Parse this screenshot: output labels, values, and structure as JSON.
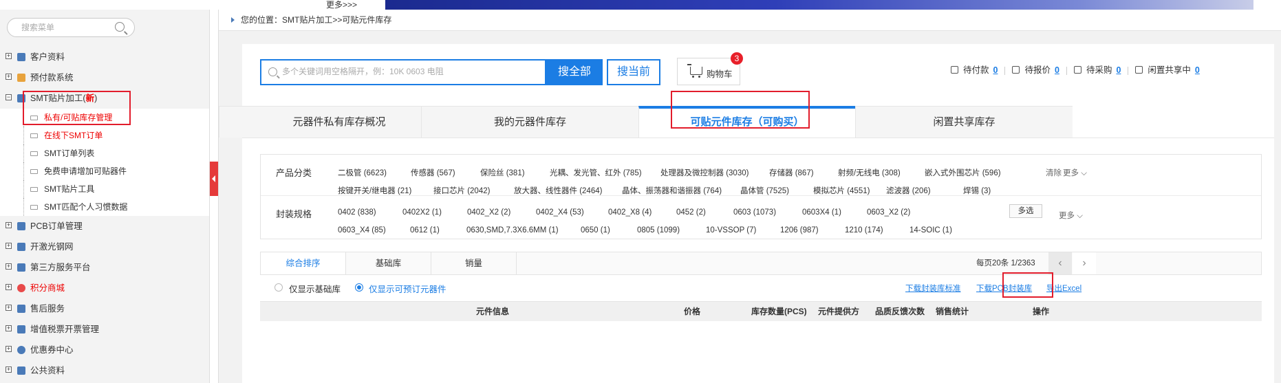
{
  "top": {
    "more_link": "更多>>>"
  },
  "sidebar": {
    "search_placeholder": "搜索菜单",
    "items": [
      {
        "label": "客户资料",
        "color": "#4a7ab8"
      },
      {
        "label": "预付款系统",
        "color": "#e8a33d"
      },
      {
        "label": "SMT贴片加工(",
        "badge": "新",
        "color": "#4a7ab8"
      },
      {
        "label": "PCB订单管理",
        "color": "#4a7ab8"
      },
      {
        "label": "开激光钢网",
        "color": "#4a7ab8"
      },
      {
        "label": "第三方服务平台",
        "color": "#4a7ab8"
      },
      {
        "label": "积分商城",
        "color": "#e84a4a"
      },
      {
        "label": "售后服务",
        "color": "#4a7ab8"
      },
      {
        "label": "增值税票开票管理",
        "color": "#4a7ab8"
      },
      {
        "label": "优惠券中心",
        "color": "#4a7ab8"
      },
      {
        "label": "公共资料",
        "color": "#4a7ab8"
      }
    ],
    "subitems": [
      {
        "label": "私有/可贴库存管理",
        "red": true
      },
      {
        "label": "在线下SMT订单",
        "red": true
      },
      {
        "label": "SMT订单列表",
        "red": false
      },
      {
        "label": "免费申请增加可贴器件",
        "red": false
      },
      {
        "label": "SMT贴片工具",
        "red": false
      },
      {
        "label": "SMT匹配个人习惯数据",
        "red": false
      }
    ]
  },
  "breadcrumb": {
    "text": "您的位置：SMT贴片加工>>可贴元件库存"
  },
  "search": {
    "placeholder": "多个关键词用空格隔开，例：10K 0603 电阻",
    "search_all": "搜全部",
    "search_current": "搜当前"
  },
  "cart": {
    "label": "购物车",
    "count": "3"
  },
  "status": [
    {
      "label": "待付款",
      "count": "0"
    },
    {
      "label": "待报价",
      "count": "0"
    },
    {
      "label": "待采购",
      "count": "0"
    },
    {
      "label": "闲置共享中",
      "count": "0"
    }
  ],
  "tabs": [
    {
      "label": "元器件私有库存概况"
    },
    {
      "label": "我的元器件库存"
    },
    {
      "label": "可贴元件库存（可购买）"
    },
    {
      "label": "闲置共享库存"
    }
  ],
  "filters": {
    "category_title": "产品分类",
    "categories_row1": [
      "二极管 (6623)",
      "传感器 (567)",
      "保险丝 (381)",
      "光耦、发光管、红外 (785)",
      "处理器及微控制器 (3030)",
      "存储器 (867)",
      "射频/无线电 (308)",
      "嵌入式外围芯片 (596)"
    ],
    "categories_row2": [
      "按键开关/继电器 (21)",
      "接口芯片 (2042)",
      "放大器、线性器件 (2464)",
      "晶体、振荡器和谐振器 (764)",
      "晶体管 (7525)",
      "模拟芯片 (4551)",
      "滤波器 (206)",
      "焊锡 (3)"
    ],
    "clear": "清除",
    "more": "更多",
    "package_title": "封装规格",
    "packages_row1": [
      "0402 (838)",
      "0402X2 (1)",
      "0402_X2 (2)",
      "0402_X4 (53)",
      "0402_X8 (4)",
      "0452 (2)",
      "0603 (1073)",
      "0603X4 (1)",
      "0603_X2 (2)"
    ],
    "packages_row2": [
      "0603_X4 (85)",
      "0612 (1)",
      "0630,SMD,7.3X6.6MM (1)",
      "0650 (1)",
      "0805 (1099)",
      "10-VSSOP (7)",
      "1206 (987)",
      "1210 (174)",
      "14-SOIC (1)"
    ],
    "multi_select": "多选"
  },
  "sort": {
    "tabs": [
      "综合排序",
      "基础库",
      "销量"
    ],
    "page_info": "每页20条 1/2363",
    "prev": "‹",
    "next": "›"
  },
  "options": {
    "only_basic": "仅显示基础库",
    "only_orderable": "仅显示可预订元器件",
    "dl_package_std": "下载封装库标准",
    "dl_pcb_package": "下载PCB封装库",
    "export_excel": "导出Excel"
  },
  "table": {
    "headers": [
      "元件信息",
      "价格",
      "库存数量(PCS)",
      "元件提供方",
      "品质反馈次数",
      "销售统计",
      "操作"
    ]
  }
}
